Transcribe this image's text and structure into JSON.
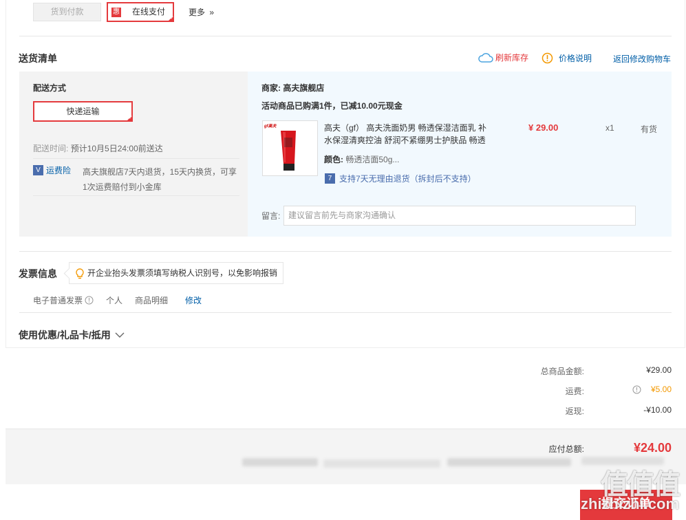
{
  "payment": {
    "cod_label": "货到付款",
    "online_label": "在线支付",
    "online_badge": "惠",
    "more_label": "更多",
    "more_glyph": "»"
  },
  "delivery": {
    "title": "送货清单",
    "refresh_label": "刷新库存",
    "price_note_label": "价格说明",
    "back_to_cart_label": "返回修改购物车",
    "method_title": "配送方式",
    "method_value": "快递运输",
    "time_label": "配送时间:",
    "time_value": "预计10月5日24:00前送达",
    "insurance_badge": "V",
    "insurance_label": "运费险",
    "insurance_desc_line1": "高夫旗舰店7天内退货，15天内换货，可享",
    "insurance_desc_line2": "1次运费赔付到小金库"
  },
  "shop": {
    "merchant_label": "商家:",
    "merchant_name": "高夫旗舰店",
    "promo_text": "活动商品已购满1件，已减10.00元现金",
    "product": {
      "thumb_brand": "gf高夫",
      "name_line1": "高夫（gf） 高夫洗面奶男 畅透保湿洁面乳 补",
      "name_line2": "水保湿清爽控油 舒润不紧绷男士护肤品 畅透",
      "price": "¥ 29.00",
      "qty": "x1",
      "stock": "有货",
      "color_label": "颜色:",
      "color_value": "畅透洁面50g...",
      "return_badge": "7",
      "return_policy": "支持7天无理由退货（拆封后不支持）"
    },
    "message_label": "留言:",
    "message_placeholder": "建议留言前先与商家沟通确认"
  },
  "invoice": {
    "title": "发票信息",
    "tip": "开企业抬头发票须填写纳税人识别号，以免影响报销",
    "type": "电子普通发票",
    "title_type": "个人",
    "content": "商品明细",
    "edit_label": "修改"
  },
  "coupon": {
    "title": "使用优惠/礼品卡/抵用"
  },
  "summary": {
    "goods_total_label": "总商品金额:",
    "goods_total_value": "¥29.00",
    "shipping_label": "运费:",
    "shipping_value": "¥5.00",
    "rebate_label": "返现:",
    "rebate_value": "-¥10.00",
    "payable_label": "应付总额:",
    "payable_value": "¥24.00",
    "submit_label": "提交订单"
  },
  "watermark": {
    "main": "值值值",
    "site": "zhizhizhi.com"
  },
  "colors": {
    "accent_red": "#e4393c",
    "link_blue": "#005ea7",
    "warning_orange": "#f39800"
  }
}
